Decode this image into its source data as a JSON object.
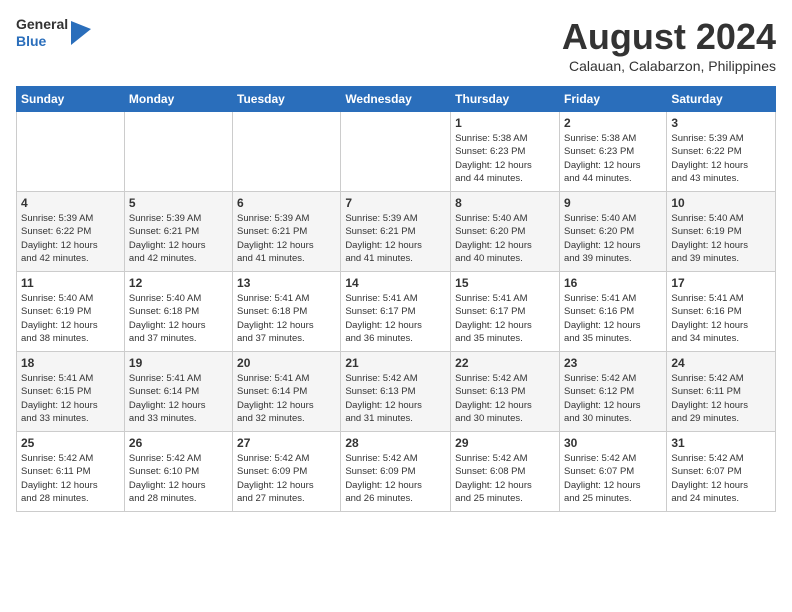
{
  "header": {
    "logo_general": "General",
    "logo_blue": "Blue",
    "month_title": "August 2024",
    "location": "Calauan, Calabarzon, Philippines"
  },
  "weekdays": [
    "Sunday",
    "Monday",
    "Tuesday",
    "Wednesday",
    "Thursday",
    "Friday",
    "Saturday"
  ],
  "weeks": [
    [
      {
        "day": "",
        "info": ""
      },
      {
        "day": "",
        "info": ""
      },
      {
        "day": "",
        "info": ""
      },
      {
        "day": "",
        "info": ""
      },
      {
        "day": "1",
        "info": "Sunrise: 5:38 AM\nSunset: 6:23 PM\nDaylight: 12 hours\nand 44 minutes."
      },
      {
        "day": "2",
        "info": "Sunrise: 5:38 AM\nSunset: 6:23 PM\nDaylight: 12 hours\nand 44 minutes."
      },
      {
        "day": "3",
        "info": "Sunrise: 5:39 AM\nSunset: 6:22 PM\nDaylight: 12 hours\nand 43 minutes."
      }
    ],
    [
      {
        "day": "4",
        "info": "Sunrise: 5:39 AM\nSunset: 6:22 PM\nDaylight: 12 hours\nand 42 minutes."
      },
      {
        "day": "5",
        "info": "Sunrise: 5:39 AM\nSunset: 6:21 PM\nDaylight: 12 hours\nand 42 minutes."
      },
      {
        "day": "6",
        "info": "Sunrise: 5:39 AM\nSunset: 6:21 PM\nDaylight: 12 hours\nand 41 minutes."
      },
      {
        "day": "7",
        "info": "Sunrise: 5:39 AM\nSunset: 6:21 PM\nDaylight: 12 hours\nand 41 minutes."
      },
      {
        "day": "8",
        "info": "Sunrise: 5:40 AM\nSunset: 6:20 PM\nDaylight: 12 hours\nand 40 minutes."
      },
      {
        "day": "9",
        "info": "Sunrise: 5:40 AM\nSunset: 6:20 PM\nDaylight: 12 hours\nand 39 minutes."
      },
      {
        "day": "10",
        "info": "Sunrise: 5:40 AM\nSunset: 6:19 PM\nDaylight: 12 hours\nand 39 minutes."
      }
    ],
    [
      {
        "day": "11",
        "info": "Sunrise: 5:40 AM\nSunset: 6:19 PM\nDaylight: 12 hours\nand 38 minutes."
      },
      {
        "day": "12",
        "info": "Sunrise: 5:40 AM\nSunset: 6:18 PM\nDaylight: 12 hours\nand 37 minutes."
      },
      {
        "day": "13",
        "info": "Sunrise: 5:41 AM\nSunset: 6:18 PM\nDaylight: 12 hours\nand 37 minutes."
      },
      {
        "day": "14",
        "info": "Sunrise: 5:41 AM\nSunset: 6:17 PM\nDaylight: 12 hours\nand 36 minutes."
      },
      {
        "day": "15",
        "info": "Sunrise: 5:41 AM\nSunset: 6:17 PM\nDaylight: 12 hours\nand 35 minutes."
      },
      {
        "day": "16",
        "info": "Sunrise: 5:41 AM\nSunset: 6:16 PM\nDaylight: 12 hours\nand 35 minutes."
      },
      {
        "day": "17",
        "info": "Sunrise: 5:41 AM\nSunset: 6:16 PM\nDaylight: 12 hours\nand 34 minutes."
      }
    ],
    [
      {
        "day": "18",
        "info": "Sunrise: 5:41 AM\nSunset: 6:15 PM\nDaylight: 12 hours\nand 33 minutes."
      },
      {
        "day": "19",
        "info": "Sunrise: 5:41 AM\nSunset: 6:14 PM\nDaylight: 12 hours\nand 33 minutes."
      },
      {
        "day": "20",
        "info": "Sunrise: 5:41 AM\nSunset: 6:14 PM\nDaylight: 12 hours\nand 32 minutes."
      },
      {
        "day": "21",
        "info": "Sunrise: 5:42 AM\nSunset: 6:13 PM\nDaylight: 12 hours\nand 31 minutes."
      },
      {
        "day": "22",
        "info": "Sunrise: 5:42 AM\nSunset: 6:13 PM\nDaylight: 12 hours\nand 30 minutes."
      },
      {
        "day": "23",
        "info": "Sunrise: 5:42 AM\nSunset: 6:12 PM\nDaylight: 12 hours\nand 30 minutes."
      },
      {
        "day": "24",
        "info": "Sunrise: 5:42 AM\nSunset: 6:11 PM\nDaylight: 12 hours\nand 29 minutes."
      }
    ],
    [
      {
        "day": "25",
        "info": "Sunrise: 5:42 AM\nSunset: 6:11 PM\nDaylight: 12 hours\nand 28 minutes."
      },
      {
        "day": "26",
        "info": "Sunrise: 5:42 AM\nSunset: 6:10 PM\nDaylight: 12 hours\nand 28 minutes."
      },
      {
        "day": "27",
        "info": "Sunrise: 5:42 AM\nSunset: 6:09 PM\nDaylight: 12 hours\nand 27 minutes."
      },
      {
        "day": "28",
        "info": "Sunrise: 5:42 AM\nSunset: 6:09 PM\nDaylight: 12 hours\nand 26 minutes."
      },
      {
        "day": "29",
        "info": "Sunrise: 5:42 AM\nSunset: 6:08 PM\nDaylight: 12 hours\nand 25 minutes."
      },
      {
        "day": "30",
        "info": "Sunrise: 5:42 AM\nSunset: 6:07 PM\nDaylight: 12 hours\nand 25 minutes."
      },
      {
        "day": "31",
        "info": "Sunrise: 5:42 AM\nSunset: 6:07 PM\nDaylight: 12 hours\nand 24 minutes."
      }
    ]
  ]
}
